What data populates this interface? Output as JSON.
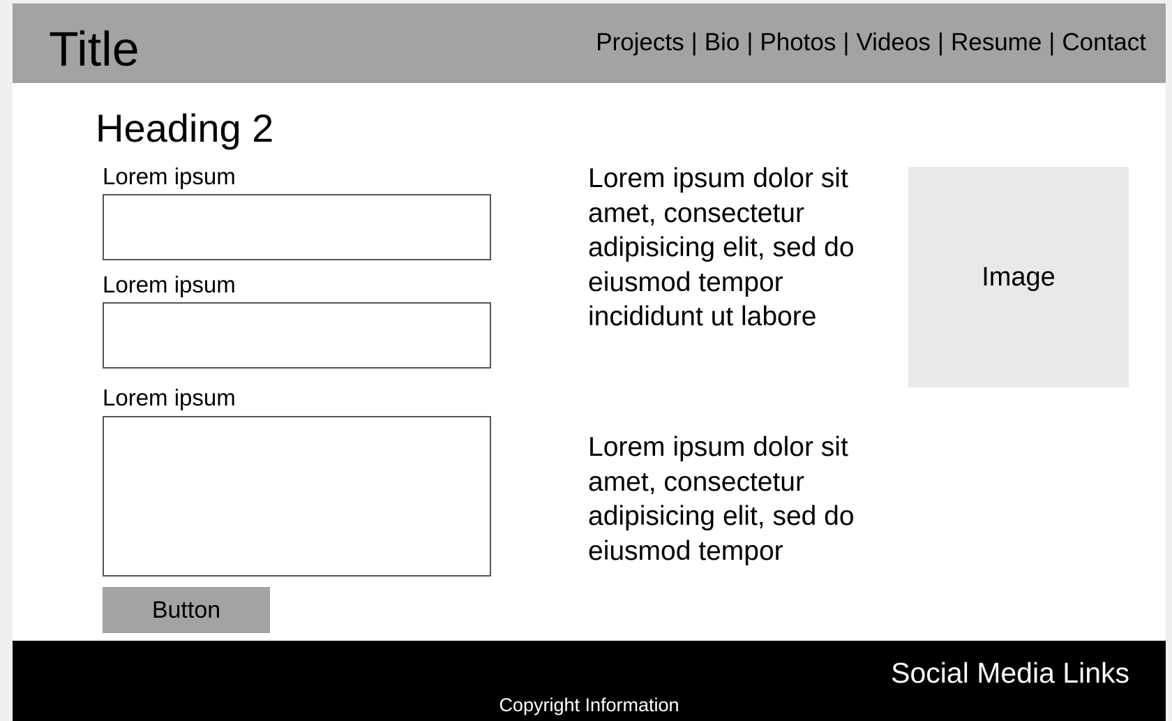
{
  "header": {
    "title": "Title",
    "nav": [
      "Projects",
      "Bio",
      "Photos",
      "Videos",
      "Resume",
      "Contact"
    ],
    "separator": "|"
  },
  "main": {
    "heading": "Heading 2",
    "form": {
      "fields": [
        {
          "label": "Lorem ipsum",
          "value": ""
        },
        {
          "label": "Lorem ipsum",
          "value": ""
        },
        {
          "label": "Lorem ipsum",
          "value": ""
        }
      ],
      "button_label": "Button"
    },
    "paragraph_1": "Lorem ipsum dolor sit amet, consectetur adipisicing elit, sed do eiusmod tempor incididunt ut labore",
    "paragraph_2": "Lorem ipsum dolor sit amet, consectetur adipisicing elit, sed do eiusmod tempor",
    "image_label": "Image"
  },
  "footer": {
    "social": "Social Media Links",
    "copyright": "Copyright Information"
  },
  "colors": {
    "header_bg": "#a3a3a3",
    "button_bg": "#a3a3a3",
    "image_bg": "#e9e9e9",
    "footer_bg": "#000000",
    "outer_bg": "#f0f0ef"
  }
}
